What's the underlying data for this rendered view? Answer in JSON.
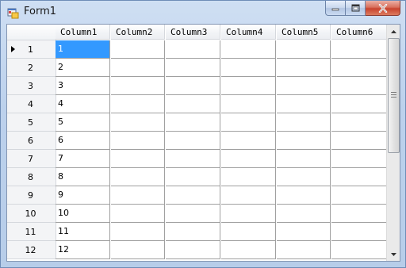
{
  "window": {
    "title": "Form1",
    "accent_color": "#3399ff",
    "controls": {
      "minimize_icon": "minimize-icon",
      "maximize_icon": "maximize-icon",
      "close_icon": "close-icon"
    }
  },
  "grid": {
    "columns": [
      "Column1",
      "Column2",
      "Column3",
      "Column4",
      "Column5",
      "Column6"
    ],
    "current_row_index": 0,
    "selected_cell": {
      "row": 0,
      "column": 0
    },
    "rows": [
      {
        "header": "1",
        "cells": [
          "1",
          "",
          "",
          "",
          "",
          ""
        ]
      },
      {
        "header": "2",
        "cells": [
          "2",
          "",
          "",
          "",
          "",
          ""
        ]
      },
      {
        "header": "3",
        "cells": [
          "3",
          "",
          "",
          "",
          "",
          ""
        ]
      },
      {
        "header": "4",
        "cells": [
          "4",
          "",
          "",
          "",
          "",
          ""
        ]
      },
      {
        "header": "5",
        "cells": [
          "5",
          "",
          "",
          "",
          "",
          ""
        ]
      },
      {
        "header": "6",
        "cells": [
          "6",
          "",
          "",
          "",
          "",
          ""
        ]
      },
      {
        "header": "7",
        "cells": [
          "7",
          "",
          "",
          "",
          "",
          ""
        ]
      },
      {
        "header": "8",
        "cells": [
          "8",
          "",
          "",
          "",
          "",
          ""
        ]
      },
      {
        "header": "9",
        "cells": [
          "9",
          "",
          "",
          "",
          "",
          ""
        ]
      },
      {
        "header": "10",
        "cells": [
          "10",
          "",
          "",
          "",
          "",
          ""
        ]
      },
      {
        "header": "11",
        "cells": [
          "11",
          "",
          "",
          "",
          "",
          ""
        ]
      },
      {
        "header": "12",
        "cells": [
          "12",
          "",
          "",
          "",
          "",
          ""
        ]
      }
    ]
  }
}
